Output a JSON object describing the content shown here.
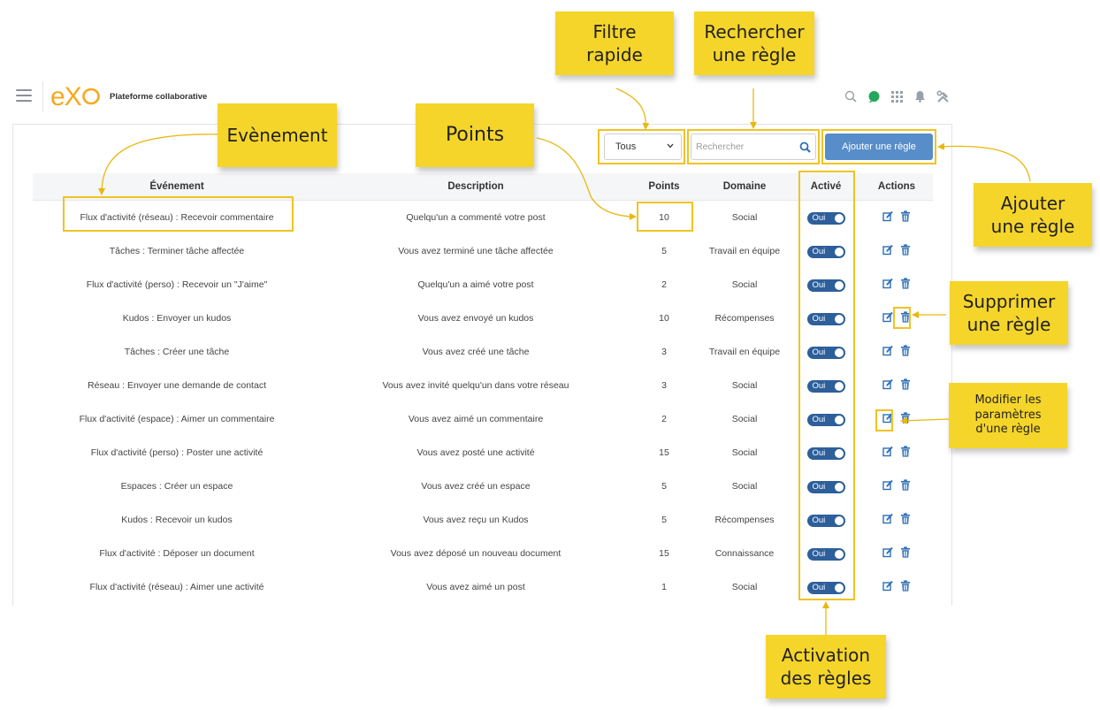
{
  "app": {
    "title": "Plateforme collaborative",
    "logo_text": "eXo"
  },
  "topbar_icons": [
    "search-icon",
    "chat-icon",
    "apps-grid-icon",
    "bell-icon",
    "admin-tools-icon"
  ],
  "toolbar": {
    "filter_value": "Tous",
    "search_placeholder": "Rechercher",
    "add_label": "Ajouter une règle"
  },
  "table": {
    "headers": [
      "Événement",
      "Description",
      "Points",
      "Domaine",
      "Activé",
      "Actions"
    ],
    "rows": [
      {
        "event": "Flux d'activité (réseau) : Recevoir commentaire",
        "description": "Quelqu'un a commenté votre post",
        "points": "10",
        "domain": "Social",
        "active": "Oui"
      },
      {
        "event": "Tâches : Terminer tâche affectée",
        "description": "Vous avez terminé une tâche affectée",
        "points": "5",
        "domain": "Travail en équipe",
        "active": "Oui"
      },
      {
        "event": "Flux d'activité (perso) : Recevoir un \"J'aime\"",
        "description": "Quelqu'un a aimé votre post",
        "points": "2",
        "domain": "Social",
        "active": "Oui"
      },
      {
        "event": "Kudos : Envoyer un kudos",
        "description": "Vous avez envoyé un kudos",
        "points": "10",
        "domain": "Récompenses",
        "active": "Oui"
      },
      {
        "event": "Tâches : Créer une tâche",
        "description": "Vous avez créé une tâche",
        "points": "3",
        "domain": "Travail en équipe",
        "active": "Oui"
      },
      {
        "event": "Réseau : Envoyer une demande de contact",
        "description": "Vous avez invité quelqu'un dans votre réseau",
        "points": "3",
        "domain": "Social",
        "active": "Oui"
      },
      {
        "event": "Flux d'activité (espace) : Aimer un commentaire",
        "description": "Vous avez aimé un commentaire",
        "points": "2",
        "domain": "Social",
        "active": "Oui"
      },
      {
        "event": "Flux d'activité (perso) : Poster une activité",
        "description": "Vous avez posté une activité",
        "points": "15",
        "domain": "Social",
        "active": "Oui"
      },
      {
        "event": "Espaces : Créer un espace",
        "description": "Vous avez créé un espace",
        "points": "5",
        "domain": "Social",
        "active": "Oui"
      },
      {
        "event": "Kudos : Recevoir un kudos",
        "description": "Vous avez reçu un Kudos",
        "points": "5",
        "domain": "Récompenses",
        "active": "Oui"
      },
      {
        "event": "Flux d'activité : Déposer un document",
        "description": "Vous avez déposé un nouveau document",
        "points": "15",
        "domain": "Connaissance",
        "active": "Oui"
      },
      {
        "event": "Flux d'activité (réseau) : Aimer une activité",
        "description": "Vous avez aimé un post",
        "points": "1",
        "domain": "Social",
        "active": "Oui"
      }
    ]
  },
  "annotations": {
    "filtre_rapide": [
      "Filtre",
      "rapide"
    ],
    "rechercher": [
      "Rechercher",
      "une règle"
    ],
    "evenement": [
      "Evènement"
    ],
    "points": [
      "Points"
    ],
    "ajouter": [
      "Ajouter",
      "une règle"
    ],
    "supprimer": [
      "Supprimer",
      "une règle"
    ],
    "modifier": [
      "Modifier les",
      "paramètres",
      "d'une règle"
    ],
    "activation": [
      "Activation",
      "des règles"
    ]
  },
  "colors": {
    "accent_button": "#578dc9",
    "toggle": "#2d5f9a",
    "action_icon": "#2d6fb6",
    "annotation": "#f5d52a",
    "highlight": "#f0c322",
    "logo": "#f7a81b"
  }
}
